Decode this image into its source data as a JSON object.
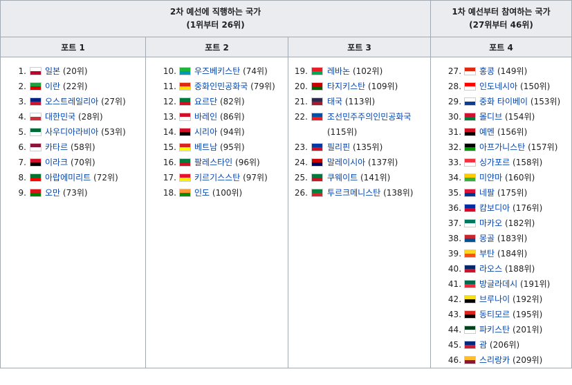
{
  "headers": {
    "group1_line1": "2차 예선에 직행하는 국가",
    "group1_line2": "(1위부터 26위)",
    "group2_line1": "1차 예선부터 참여하는 국가",
    "group2_line2": "(27위부터 46위)",
    "pots": [
      "포트 1",
      "포트 2",
      "포트 3",
      "포트 4"
    ]
  },
  "pots": [
    [
      {
        "num": "1.",
        "name": "일본",
        "rank": "(20위)",
        "flag": "#ffffff",
        "accent": "#bc002d"
      },
      {
        "num": "2.",
        "name": "이란",
        "rank": "(22위)",
        "flag": "#239f40",
        "accent": "#da0000"
      },
      {
        "num": "3.",
        "name": "오스트레일리아",
        "rank": "(27위)",
        "flag": "#00247d",
        "accent": "#cf142b"
      },
      {
        "num": "4.",
        "name": "대한민국",
        "rank": "(28위)",
        "flag": "#ffffff",
        "accent": "#cd2e3a"
      },
      {
        "num": "5.",
        "name": "사우디아라비아",
        "rank": "(53위)",
        "flag": "#006c35",
        "accent": "#ffffff"
      },
      {
        "num": "6.",
        "name": "카타르",
        "rank": "(58위)",
        "flag": "#8a1538",
        "accent": "#ffffff"
      },
      {
        "num": "7.",
        "name": "이라크",
        "rank": "(70위)",
        "flag": "#ce1126",
        "accent": "#000000"
      },
      {
        "num": "8.",
        "name": "아랍에미리트",
        "rank": "(72위)",
        "flag": "#00732f",
        "accent": "#ff0000"
      },
      {
        "num": "9.",
        "name": "오만",
        "rank": "(73위)",
        "flag": "#db161b",
        "accent": "#008000"
      }
    ],
    [
      {
        "num": "10.",
        "name": "우즈베키스탄",
        "rank": "(74위)",
        "flag": "#1eb53a",
        "accent": "#0099b5"
      },
      {
        "num": "11.",
        "name": "중화인민공화국",
        "rank": "(79위)",
        "flag": "#de2910",
        "accent": "#ffde00"
      },
      {
        "num": "12.",
        "name": "요르단",
        "rank": "(82위)",
        "flag": "#007a3d",
        "accent": "#ce1126"
      },
      {
        "num": "13.",
        "name": "바레인",
        "rank": "(86위)",
        "flag": "#ce1126",
        "accent": "#ffffff"
      },
      {
        "num": "14.",
        "name": "시리아",
        "rank": "(94위)",
        "flag": "#ce1126",
        "accent": "#000000"
      },
      {
        "num": "15.",
        "name": "베트남",
        "rank": "(95위)",
        "flag": "#da251d",
        "accent": "#ffff00"
      },
      {
        "num": "16.",
        "name": "팔레스타인",
        "rank": "(96위)",
        "flag": "#007a3d",
        "accent": "#ce1126"
      },
      {
        "num": "17.",
        "name": "키르기스스탄",
        "rank": "(97위)",
        "flag": "#e8112d",
        "accent": "#ffef00"
      },
      {
        "num": "18.",
        "name": "인도",
        "rank": "(100위)",
        "flag": "#ff9933",
        "accent": "#138808"
      }
    ],
    [
      {
        "num": "19.",
        "name": "레바논",
        "rank": "(102위)",
        "flag": "#ed1c24",
        "accent": "#00a651"
      },
      {
        "num": "20.",
        "name": "타지키스탄",
        "rank": "(109위)",
        "flag": "#cc0000",
        "accent": "#006600"
      },
      {
        "num": "21.",
        "name": "태국",
        "rank": "(113위)",
        "flag": "#2d2a4a",
        "accent": "#a51931"
      },
      {
        "num": "22.",
        "name": "조선민주주의인민공화국",
        "rank": "(115위)",
        "flag": "#024fa2",
        "accent": "#ed1c27"
      },
      {
        "num": "23.",
        "name": "필리핀",
        "rank": "(135위)",
        "flag": "#0038a8",
        "accent": "#ce1126"
      },
      {
        "num": "24.",
        "name": "말레이시아",
        "rank": "(137위)",
        "flag": "#cc0001",
        "accent": "#010066"
      },
      {
        "num": "25.",
        "name": "쿠웨이트",
        "rank": "(141위)",
        "flag": "#007a3d",
        "accent": "#ce1126"
      },
      {
        "num": "26.",
        "name": "투르크메니스탄",
        "rank": "(138위)",
        "flag": "#00843d",
        "accent": "#d22630"
      }
    ],
    [
      {
        "num": "27.",
        "name": "홍콩",
        "rank": "(149위)",
        "flag": "#de2910",
        "accent": "#ffffff"
      },
      {
        "num": "28.",
        "name": "인도네시아",
        "rank": "(150위)",
        "flag": "#ff0000",
        "accent": "#ffffff"
      },
      {
        "num": "29.",
        "name": "중화 타이베이",
        "rank": "(153위)",
        "flag": "#ffffff",
        "accent": "#0b3d91"
      },
      {
        "num": "30.",
        "name": "몰디브",
        "rank": "(154위)",
        "flag": "#d21034",
        "accent": "#007e3a"
      },
      {
        "num": "31.",
        "name": "예멘",
        "rank": "(156위)",
        "flag": "#ce1126",
        "accent": "#000000"
      },
      {
        "num": "32.",
        "name": "아프가니스탄",
        "rank": "(157위)",
        "flag": "#000000",
        "accent": "#009900"
      },
      {
        "num": "33.",
        "name": "싱가포르",
        "rank": "(158위)",
        "flag": "#ef3340",
        "accent": "#ffffff"
      },
      {
        "num": "34.",
        "name": "미얀마",
        "rank": "(160위)",
        "flag": "#fecb00",
        "accent": "#34b233"
      },
      {
        "num": "35.",
        "name": "네팔",
        "rank": "(175위)",
        "flag": "#dc143c",
        "accent": "#003893"
      },
      {
        "num": "36.",
        "name": "캄보디아",
        "rank": "(176위)",
        "flag": "#032ea1",
        "accent": "#e00025"
      },
      {
        "num": "37.",
        "name": "마카오",
        "rank": "(182위)",
        "flag": "#00785e",
        "accent": "#ffffff"
      },
      {
        "num": "38.",
        "name": "몽골",
        "rank": "(183위)",
        "flag": "#c4272f",
        "accent": "#015197"
      },
      {
        "num": "39.",
        "name": "부탄",
        "rank": "(184위)",
        "flag": "#ffd520",
        "accent": "#ff4e12"
      },
      {
        "num": "40.",
        "name": "라오스",
        "rank": "(188위)",
        "flag": "#002868",
        "accent": "#ce1126"
      },
      {
        "num": "41.",
        "name": "방글라데시",
        "rank": "(191위)",
        "flag": "#006a4e",
        "accent": "#f42a41"
      },
      {
        "num": "42.",
        "name": "브루나이",
        "rank": "(192위)",
        "flag": "#f7e017",
        "accent": "#000000"
      },
      {
        "num": "43.",
        "name": "동티모르",
        "rank": "(195위)",
        "flag": "#dc241f",
        "accent": "#000000"
      },
      {
        "num": "44.",
        "name": "파키스탄",
        "rank": "(201위)",
        "flag": "#01411c",
        "accent": "#ffffff"
      },
      {
        "num": "45.",
        "name": "괌",
        "rank": "(206위)",
        "flag": "#00297b",
        "accent": "#c62139"
      },
      {
        "num": "46.",
        "name": "스리랑카",
        "rank": "(209위)",
        "flag": "#ffbe29",
        "accent": "#8d153a"
      }
    ]
  ]
}
